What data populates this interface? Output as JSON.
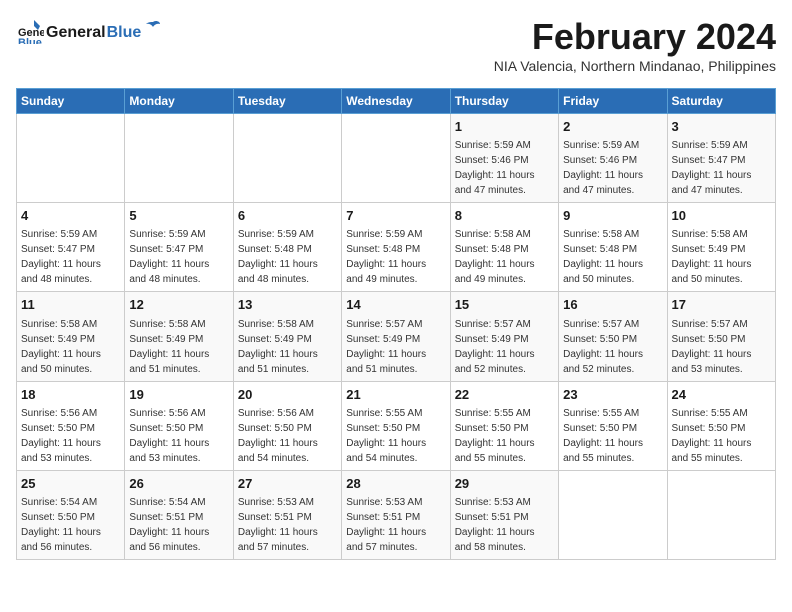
{
  "header": {
    "logo_general": "General",
    "logo_blue": "Blue",
    "month_title": "February 2024",
    "subtitle": "NIA Valencia, Northern Mindanao, Philippines"
  },
  "days_of_week": [
    "Sunday",
    "Monday",
    "Tuesday",
    "Wednesday",
    "Thursday",
    "Friday",
    "Saturday"
  ],
  "weeks": [
    [
      {
        "day": "",
        "info": ""
      },
      {
        "day": "",
        "info": ""
      },
      {
        "day": "",
        "info": ""
      },
      {
        "day": "",
        "info": ""
      },
      {
        "day": "1",
        "info": "Sunrise: 5:59 AM\nSunset: 5:46 PM\nDaylight: 11 hours\nand 47 minutes."
      },
      {
        "day": "2",
        "info": "Sunrise: 5:59 AM\nSunset: 5:46 PM\nDaylight: 11 hours\nand 47 minutes."
      },
      {
        "day": "3",
        "info": "Sunrise: 5:59 AM\nSunset: 5:47 PM\nDaylight: 11 hours\nand 47 minutes."
      }
    ],
    [
      {
        "day": "4",
        "info": "Sunrise: 5:59 AM\nSunset: 5:47 PM\nDaylight: 11 hours\nand 48 minutes."
      },
      {
        "day": "5",
        "info": "Sunrise: 5:59 AM\nSunset: 5:47 PM\nDaylight: 11 hours\nand 48 minutes."
      },
      {
        "day": "6",
        "info": "Sunrise: 5:59 AM\nSunset: 5:48 PM\nDaylight: 11 hours\nand 48 minutes."
      },
      {
        "day": "7",
        "info": "Sunrise: 5:59 AM\nSunset: 5:48 PM\nDaylight: 11 hours\nand 49 minutes."
      },
      {
        "day": "8",
        "info": "Sunrise: 5:58 AM\nSunset: 5:48 PM\nDaylight: 11 hours\nand 49 minutes."
      },
      {
        "day": "9",
        "info": "Sunrise: 5:58 AM\nSunset: 5:48 PM\nDaylight: 11 hours\nand 50 minutes."
      },
      {
        "day": "10",
        "info": "Sunrise: 5:58 AM\nSunset: 5:49 PM\nDaylight: 11 hours\nand 50 minutes."
      }
    ],
    [
      {
        "day": "11",
        "info": "Sunrise: 5:58 AM\nSunset: 5:49 PM\nDaylight: 11 hours\nand 50 minutes."
      },
      {
        "day": "12",
        "info": "Sunrise: 5:58 AM\nSunset: 5:49 PM\nDaylight: 11 hours\nand 51 minutes."
      },
      {
        "day": "13",
        "info": "Sunrise: 5:58 AM\nSunset: 5:49 PM\nDaylight: 11 hours\nand 51 minutes."
      },
      {
        "day": "14",
        "info": "Sunrise: 5:57 AM\nSunset: 5:49 PM\nDaylight: 11 hours\nand 51 minutes."
      },
      {
        "day": "15",
        "info": "Sunrise: 5:57 AM\nSunset: 5:49 PM\nDaylight: 11 hours\nand 52 minutes."
      },
      {
        "day": "16",
        "info": "Sunrise: 5:57 AM\nSunset: 5:50 PM\nDaylight: 11 hours\nand 52 minutes."
      },
      {
        "day": "17",
        "info": "Sunrise: 5:57 AM\nSunset: 5:50 PM\nDaylight: 11 hours\nand 53 minutes."
      }
    ],
    [
      {
        "day": "18",
        "info": "Sunrise: 5:56 AM\nSunset: 5:50 PM\nDaylight: 11 hours\nand 53 minutes."
      },
      {
        "day": "19",
        "info": "Sunrise: 5:56 AM\nSunset: 5:50 PM\nDaylight: 11 hours\nand 53 minutes."
      },
      {
        "day": "20",
        "info": "Sunrise: 5:56 AM\nSunset: 5:50 PM\nDaylight: 11 hours\nand 54 minutes."
      },
      {
        "day": "21",
        "info": "Sunrise: 5:55 AM\nSunset: 5:50 PM\nDaylight: 11 hours\nand 54 minutes."
      },
      {
        "day": "22",
        "info": "Sunrise: 5:55 AM\nSunset: 5:50 PM\nDaylight: 11 hours\nand 55 minutes."
      },
      {
        "day": "23",
        "info": "Sunrise: 5:55 AM\nSunset: 5:50 PM\nDaylight: 11 hours\nand 55 minutes."
      },
      {
        "day": "24",
        "info": "Sunrise: 5:55 AM\nSunset: 5:50 PM\nDaylight: 11 hours\nand 55 minutes."
      }
    ],
    [
      {
        "day": "25",
        "info": "Sunrise: 5:54 AM\nSunset: 5:50 PM\nDaylight: 11 hours\nand 56 minutes."
      },
      {
        "day": "26",
        "info": "Sunrise: 5:54 AM\nSunset: 5:51 PM\nDaylight: 11 hours\nand 56 minutes."
      },
      {
        "day": "27",
        "info": "Sunrise: 5:53 AM\nSunset: 5:51 PM\nDaylight: 11 hours\nand 57 minutes."
      },
      {
        "day": "28",
        "info": "Sunrise: 5:53 AM\nSunset: 5:51 PM\nDaylight: 11 hours\nand 57 minutes."
      },
      {
        "day": "29",
        "info": "Sunrise: 5:53 AM\nSunset: 5:51 PM\nDaylight: 11 hours\nand 58 minutes."
      },
      {
        "day": "",
        "info": ""
      },
      {
        "day": "",
        "info": ""
      }
    ]
  ]
}
